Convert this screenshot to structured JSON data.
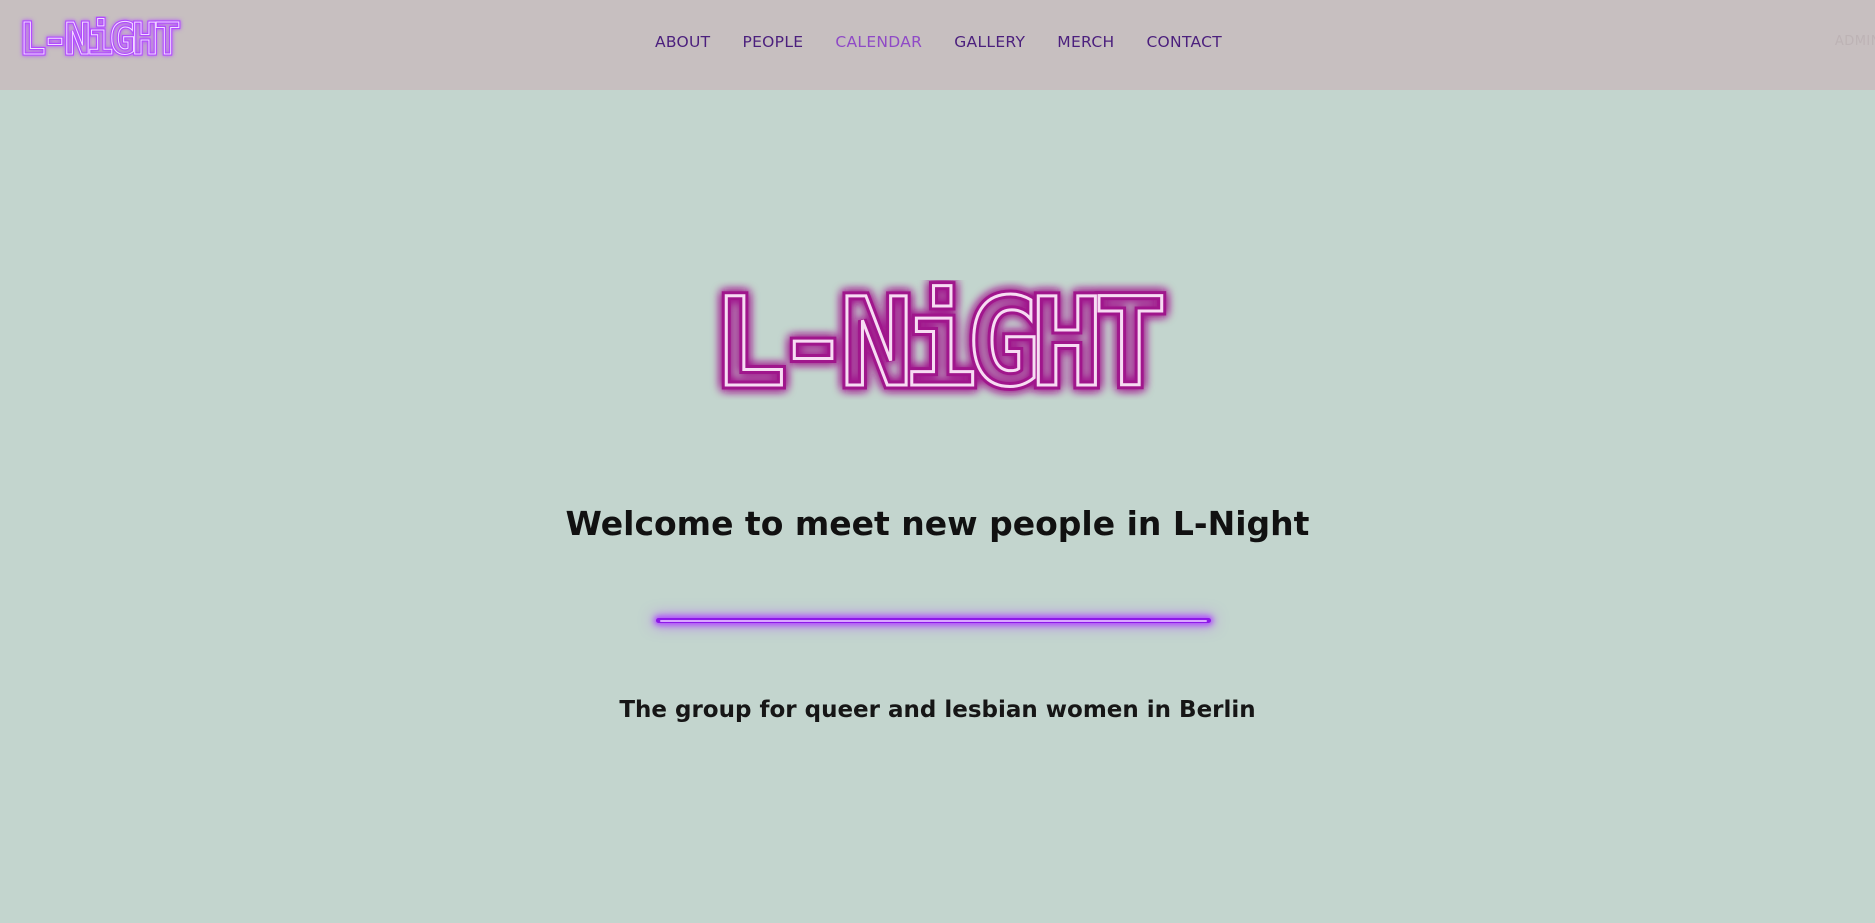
{
  "header": {
    "logo_text": "L-NiGHT",
    "nav": [
      {
        "label": "ABOUT",
        "active": false
      },
      {
        "label": "PEOPLE",
        "active": false
      },
      {
        "label": "CALENDAR",
        "active": true
      },
      {
        "label": "GALLERY",
        "active": false
      },
      {
        "label": "MERCH",
        "active": false
      },
      {
        "label": "CONTACT",
        "active": false
      }
    ],
    "admin_label": "ADMIN"
  },
  "hero": {
    "logo_text": "L-NiGHT",
    "welcome": "Welcome to meet new people in L-Night",
    "tagline": "The group for queer and lesbian women in Berlin"
  },
  "colors": {
    "header_bg": "#c7bfc0",
    "page_bg": "#c3d5ce",
    "nav_text": "#4b1f7d",
    "nav_active": "#8f4ac6",
    "neon_purple": "#8d18e8",
    "neon_pink": "#b0239a"
  }
}
